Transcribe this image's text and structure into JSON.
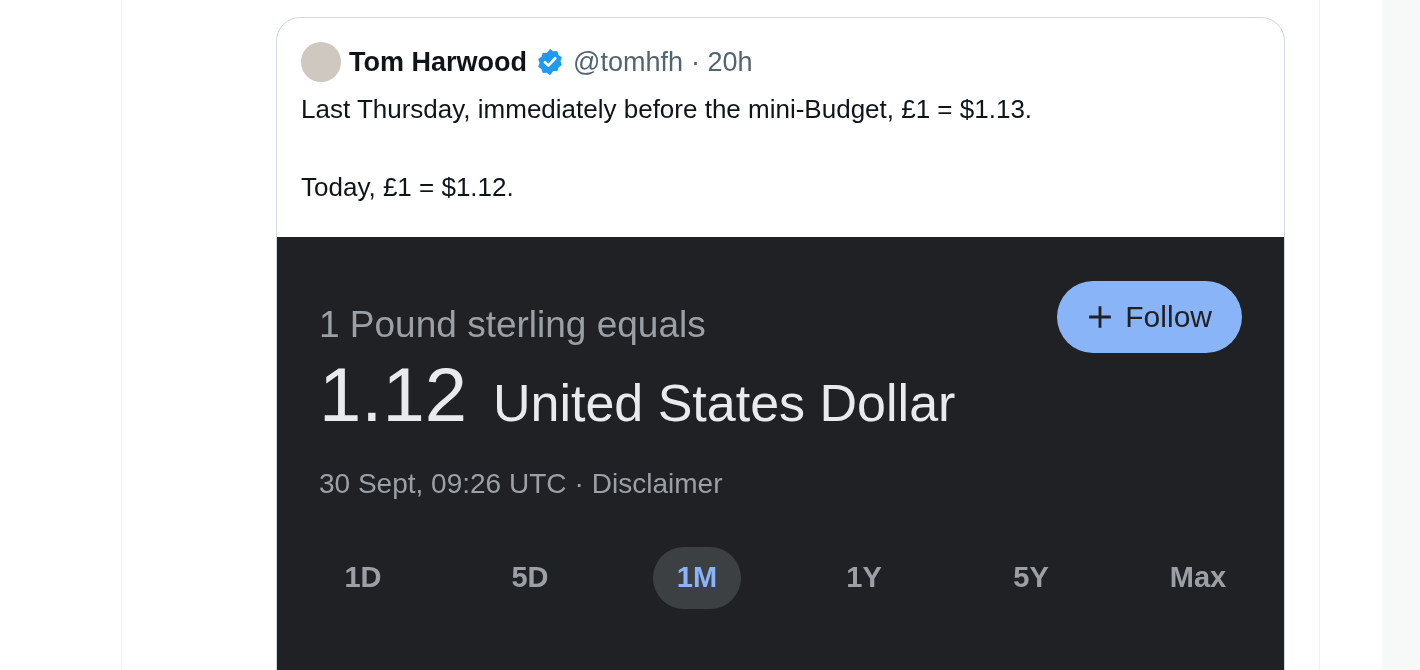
{
  "tweet": {
    "author": "Tom Harwood",
    "verified": true,
    "handle": "@tomhfh",
    "time": "· 20h",
    "paragraphs": [
      "Last Thursday, immediately before the mini-Budget, £1 = $1.13.",
      "Today, £1 = $1.12."
    ],
    "embed": {
      "heading": "1 Pound sterling equals",
      "follow_button": "Follow",
      "rate": "1.12",
      "currency": "United States Dollar",
      "timestamp": "30 Sept, 09:26 UTC",
      "separator": "·",
      "disclaimer": "Disclaimer",
      "ranges": [
        {
          "label": "1D",
          "selected": false
        },
        {
          "label": "5D",
          "selected": false
        },
        {
          "label": "1M",
          "selected": true
        },
        {
          "label": "1Y",
          "selected": false
        },
        {
          "label": "5Y",
          "selected": false
        },
        {
          "label": "Max",
          "selected": false
        }
      ]
    }
  }
}
